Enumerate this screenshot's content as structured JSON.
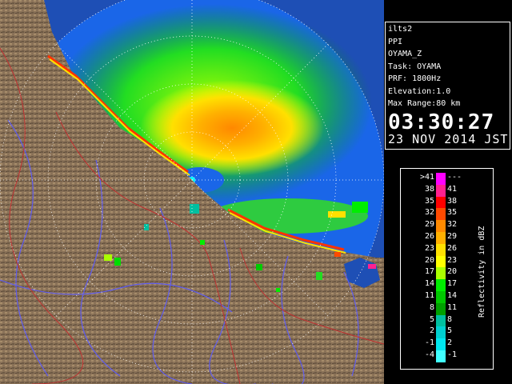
{
  "info": {
    "lines": [
      "ilts2",
      "PPI",
      "OYAMA_Z",
      "Task: OYAMA",
      "PRF: 1800Hz",
      "Elevation:1.0",
      "Max Range:80 km"
    ],
    "time": "03:30:27",
    "date": "23 NOV 2014 JST"
  },
  "legend": {
    "unit": "Reflectivity in dBZ",
    "bins": [
      {
        "low": ">41",
        "high": "---",
        "color": "#ff00ff"
      },
      {
        "low": "38",
        "high": "41",
        "color": "#ff2090"
      },
      {
        "low": "35",
        "high": "38",
        "color": "#ff0000"
      },
      {
        "low": "32",
        "high": "35",
        "color": "#ff4a00"
      },
      {
        "low": "29",
        "high": "32",
        "color": "#ff8a00"
      },
      {
        "low": "26",
        "high": "29",
        "color": "#ffb000"
      },
      {
        "low": "23",
        "high": "26",
        "color": "#ffe000"
      },
      {
        "low": "20",
        "high": "23",
        "color": "#ffff00"
      },
      {
        "low": "17",
        "high": "20",
        "color": "#aaff00"
      },
      {
        "low": "14",
        "high": "17",
        "color": "#00ee00"
      },
      {
        "low": "11",
        "high": "14",
        "color": "#00c800"
      },
      {
        "low": "8",
        "high": "11",
        "color": "#00a000"
      },
      {
        "low": "5",
        "high": "8",
        "color": "#00c0a0"
      },
      {
        "low": "2",
        "high": "5",
        "color": "#00d0d0"
      },
      {
        "low": "-1",
        "high": "2",
        "color": "#00e8f0"
      },
      {
        "low": "-4",
        "high": "-1",
        "color": "#40ffff"
      }
    ]
  },
  "colors": {
    "ocean": "#1e4fb5",
    "range_disc": "#1a66e8",
    "land": "#8a7258",
    "coast_line": "#7aa0ff",
    "rivers": "#5a5aff",
    "borders": "#c03030"
  }
}
